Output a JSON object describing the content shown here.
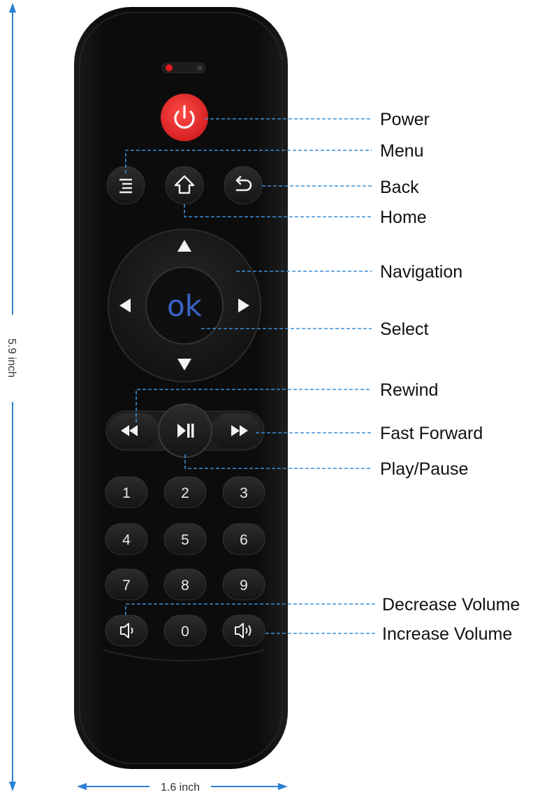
{
  "callouts": {
    "power": "Power",
    "menu": "Menu",
    "back": "Back",
    "home": "Home",
    "navigation": "Navigation",
    "select": "Select",
    "rewind": "Rewind",
    "fast_forward": "Fast Forward",
    "play_pause": "Play/Pause",
    "decrease_volume": "Decrease Volume",
    "increase_volume": "Increase Volume"
  },
  "dimensions": {
    "height": "5.9 inch",
    "width": "1.6 inch"
  },
  "keys": {
    "ok": "ok",
    "digits": [
      "1",
      "2",
      "3",
      "4",
      "5",
      "6",
      "7",
      "8",
      "9",
      "0"
    ]
  },
  "icons": [
    "power-icon",
    "menu-icon",
    "home-icon",
    "back-icon",
    "up-arrow-icon",
    "down-arrow-icon",
    "left-arrow-icon",
    "right-arrow-icon",
    "rewind-icon",
    "play-pause-icon",
    "fast-forward-icon",
    "volume-down-icon",
    "volume-up-icon"
  ],
  "colors": {
    "remote_body": "#0e0e0e",
    "power_button": "#e5262a",
    "ok_text": "#3b63c8",
    "leader_lines": "#3a8fd8",
    "dimension_arrows": "#2a7fd4"
  }
}
